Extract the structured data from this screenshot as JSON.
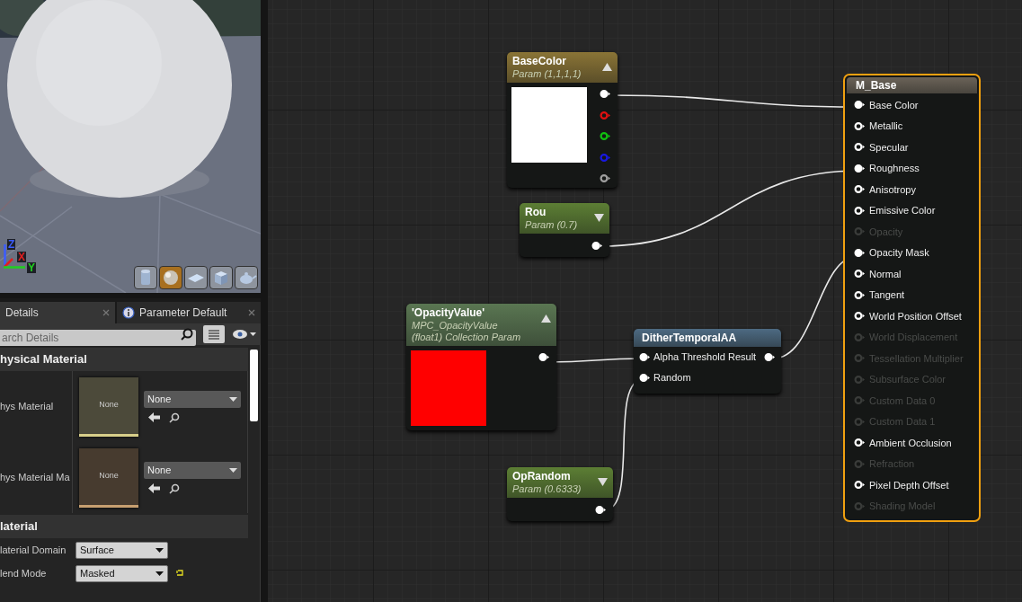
{
  "viewport": {
    "axes": [
      {
        "label": "Z",
        "color": "#3a5cff"
      },
      {
        "label": "X",
        "color": "#e02020"
      },
      {
        "label": "Y",
        "color": "#20d020"
      }
    ],
    "preview_buttons": [
      {
        "kind": "cylinder",
        "selected": false
      },
      {
        "kind": "sphere",
        "selected": true
      },
      {
        "kind": "plane",
        "selected": false
      },
      {
        "kind": "cube",
        "selected": false
      },
      {
        "kind": "teapot",
        "selected": false
      }
    ]
  },
  "details": {
    "tabs": [
      {
        "label": "Details",
        "kind": "plain",
        "selected": true
      },
      {
        "label": "Parameter Default",
        "kind": "info",
        "selected": false
      }
    ],
    "search": {
      "placeholder": "arch Details"
    },
    "sections": [
      {
        "title": "hysical Material",
        "properties": [
          {
            "kind": "asset",
            "label": "hys Material",
            "thumbnail": "None",
            "value": "None",
            "color": "#d8cf8a"
          },
          {
            "kind": "asset",
            "label": "hys Material Ma",
            "thumbnail": "None",
            "value": "None",
            "color": "#c8a070"
          }
        ]
      },
      {
        "title": "laterial",
        "properties": [
          {
            "kind": "dropdown",
            "label": "laterial Domain",
            "value": "Surface",
            "modified": false
          },
          {
            "kind": "dropdown",
            "label": "lend Mode",
            "value": "Masked",
            "modified": true
          }
        ]
      }
    ]
  },
  "graph": {
    "nodes": [
      {
        "kind": "param",
        "title": "BaseColor",
        "subtitle": [
          "Param (1,1,1,1)"
        ],
        "color": "#8a7436",
        "expanded": true,
        "preview": {
          "color": "#ffffff"
        },
        "outputs": [
          {
            "color": "#ffffff",
            "connected": true
          },
          {
            "color": "#e01010",
            "connected": false
          },
          {
            "color": "#10c010",
            "connected": false
          },
          {
            "color": "#1818e0",
            "connected": false
          },
          {
            "color": "#a0a0a0",
            "connected": false
          }
        ]
      },
      {
        "kind": "param",
        "title": "Rou",
        "subtitle": [
          "Param (0.7)"
        ],
        "color": "#5c7e34",
        "expanded": false,
        "outputs": [
          {
            "color": "#ffffff",
            "connected": true
          }
        ]
      },
      {
        "kind": "param",
        "title": "'OpacityValue'",
        "subtitle": [
          "MPC_OpacityValue",
          "(float1) Collection Param"
        ],
        "color": "#5a7652",
        "expanded": true,
        "preview": {
          "color": "#ff0000"
        },
        "outputs": [
          {
            "color": "#ffffff",
            "connected": true
          }
        ]
      },
      {
        "kind": "param",
        "title": "OpRandom",
        "subtitle": [
          "Param (0.6333)"
        ],
        "color": "#5c7e34",
        "expanded": false,
        "outputs": [
          {
            "color": "#ffffff",
            "connected": true
          }
        ]
      },
      {
        "kind": "function",
        "title": "DitherTemporalAA",
        "color": "#4d6a82",
        "rows": [
          {
            "label": "Alpha Threshold Result",
            "connected": true,
            "output_connected": true
          },
          {
            "label": "Random",
            "connected": true
          }
        ]
      },
      {
        "kind": "result",
        "title": "M_Base",
        "color": "#6b6358",
        "selected": true,
        "pins": [
          {
            "label": "Base Color",
            "connected": true,
            "disabled": false
          },
          {
            "label": "Metallic",
            "connected": false,
            "disabled": false
          },
          {
            "label": "Specular",
            "connected": false,
            "disabled": false
          },
          {
            "label": "Roughness",
            "connected": true,
            "disabled": false
          },
          {
            "label": "Anisotropy",
            "connected": false,
            "disabled": false
          },
          {
            "label": "Emissive Color",
            "connected": false,
            "disabled": false
          },
          {
            "label": "Opacity",
            "connected": false,
            "disabled": true
          },
          {
            "label": "Opacity Mask",
            "connected": true,
            "disabled": false
          },
          {
            "label": "Normal",
            "connected": false,
            "disabled": false
          },
          {
            "label": "Tangent",
            "connected": false,
            "disabled": false
          },
          {
            "label": "World Position Offset",
            "connected": false,
            "disabled": false
          },
          {
            "label": "World Displacement",
            "connected": false,
            "disabled": true
          },
          {
            "label": "Tessellation Multiplier",
            "connected": false,
            "disabled": true
          },
          {
            "label": "Subsurface Color",
            "connected": false,
            "disabled": true
          },
          {
            "label": "Custom Data 0",
            "connected": false,
            "disabled": true
          },
          {
            "label": "Custom Data 1",
            "connected": false,
            "disabled": true
          },
          {
            "label": "Ambient Occlusion",
            "connected": false,
            "disabled": false
          },
          {
            "label": "Refraction",
            "connected": false,
            "disabled": true
          },
          {
            "label": "Pixel Depth Offset",
            "connected": false,
            "disabled": false
          },
          {
            "label": "Shading Model",
            "connected": false,
            "disabled": true
          }
        ]
      }
    ]
  }
}
